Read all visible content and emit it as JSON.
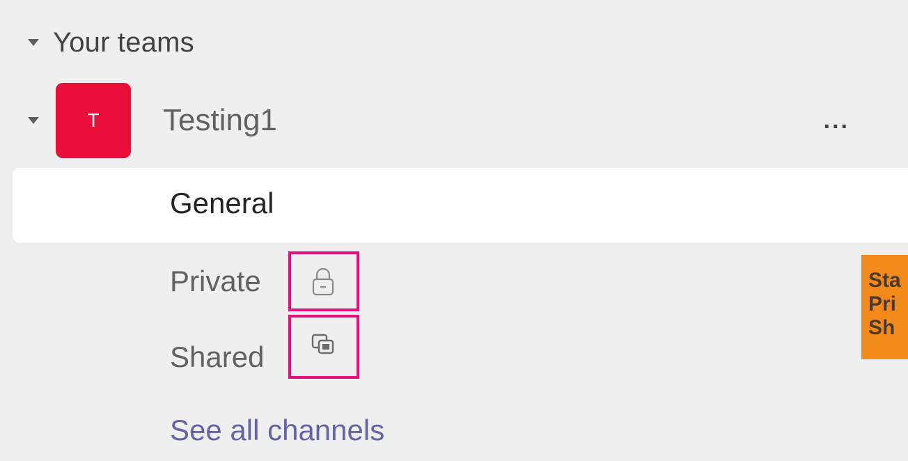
{
  "sidebar": {
    "section_label": "Your teams",
    "team": {
      "avatar_initial": "T",
      "name": "Testing1",
      "more_label": "...",
      "avatar_color": "#e8103b"
    },
    "channels": {
      "general": "General",
      "private": "Private",
      "shared": "Shared"
    },
    "see_all_label": "See all channels",
    "link_color": "#6264a7"
  },
  "annotation": {
    "highlight_color": "#e3127c",
    "callout_color": "#f28b1b",
    "callout_lines": [
      "Sta",
      "Pri",
      "Sh"
    ]
  }
}
